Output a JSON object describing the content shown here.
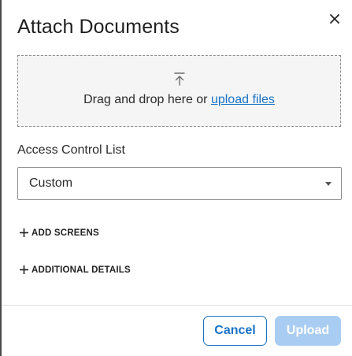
{
  "dialog": {
    "title": "Attach Documents",
    "close_icon": "close-icon"
  },
  "dropzone": {
    "icon": "upload-arrow-icon",
    "text": "Drag and drop here or ",
    "link_text": "upload files"
  },
  "acl": {
    "label": "Access Control List",
    "selected": "Custom"
  },
  "sections": {
    "add_screens": "ADD SCREENS",
    "additional_details": "ADDITIONAL DETAILS"
  },
  "footer": {
    "cancel_label": "Cancel",
    "upload_label": "Upload"
  },
  "colors": {
    "accent": "#1a73c7",
    "upload_disabled": "#a9cdf2",
    "dropzone_bg": "#f5f5f5"
  }
}
